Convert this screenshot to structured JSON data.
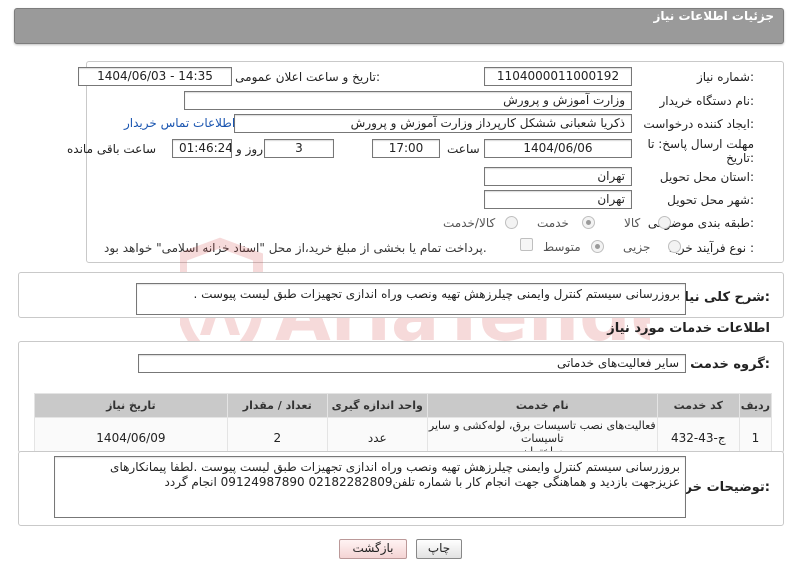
{
  "header": {
    "title": "جزئیات اطلاعات نیاز"
  },
  "need_number": {
    "label": "شماره نیاز:",
    "value": "1104000011000192"
  },
  "announce_datetime": {
    "label": "تاریخ و ساعت اعلان عمومی:",
    "value": "1404/06/03 - 14:35"
  },
  "buyer_org": {
    "label": "نام دستگاه خریدار:",
    "value": "وزارت آموزش و پرورش"
  },
  "requester": {
    "label": "ایجاد کننده درخواست:",
    "value": "ذکریا شعبانی ششکل کارپرداز وزارت آموزش و پرورش",
    "contact_link": "اطلاعات تماس خریدار"
  },
  "deadline": {
    "label_line1": "مهلت ارسال پاسخ: تا",
    "label_line2": "تاریخ:",
    "date": "1404/06/06",
    "time_label": "ساعت",
    "time": "17:00",
    "days": "3",
    "days_label": "روز و",
    "remaining": "01:46:24",
    "remaining_label": "ساعت باقی مانده"
  },
  "delivery_province": {
    "label": "استان محل تحویل:",
    "value": "تهران"
  },
  "delivery_city": {
    "label": "شهر محل تحویل:",
    "value": "تهران"
  },
  "category": {
    "label": "طبقه بندی موضوعی:",
    "options": [
      "کالا",
      "خدمت",
      "کالا/خدمت"
    ],
    "selected": "خدمت"
  },
  "purchase_type": {
    "label": "نوع فرآیند خرید :",
    "options": [
      "جزیی",
      "متوسط"
    ],
    "selected": "متوسط",
    "note": "پرداخت تمام یا بخشی از مبلغ خرید،از محل \"اسناد خزانه اسلامی\" خواهد بود."
  },
  "general_description": {
    "label": "شرح کلی نیاز:",
    "value": "بروزرسانی سیستم کنترل وایمنی چیلرزهش تهیه ونصب وراه اندازی تجهیزات طبق لیست پیوست ."
  },
  "services_section": {
    "title": "اطلاعات خدمات مورد نیاز"
  },
  "service_group": {
    "label": "گروه خدمت:",
    "value": "سایر فعالیت‌های خدماتی"
  },
  "items_table": {
    "columns": [
      "ردیف",
      "کد خدمت",
      "نام خدمت",
      "واحد اندازه گیری",
      "تعداد / مقدار",
      "تاریخ نیاز"
    ],
    "rows": [
      {
        "row": "1",
        "code": "ج-43-432",
        "name_line1": "فعالیت‌های نصب تاسیسات برق، لوله‌کشی و سایر تاسیسات",
        "name_line2": "ساختمان",
        "unit": "عدد",
        "qty": "2",
        "date": "1404/06/09"
      }
    ]
  },
  "buyer_notes": {
    "label": "توضیحات خریدار:",
    "line1": "بروزرسانی سیستم کنترل وایمنی چیلرزهش تهیه ونصب وراه اندازی تجهیزات طبق لیست پیوست .لطفا پیمانکارهای",
    "line2": "عزیزجهت بازدید و هماهنگی جهت انجام کار با شماره تلفن02182282809    09124987890 انجام گردد"
  },
  "buttons": {
    "print": "چاپ",
    "back": "بازگشت"
  },
  "watermark": {
    "text": "AriaTender.net"
  },
  "colors": {
    "header": "#9a9a9a",
    "link": "#1a55b0",
    "back_button": "#f4d4d4",
    "watermark": "#d23a3a"
  }
}
